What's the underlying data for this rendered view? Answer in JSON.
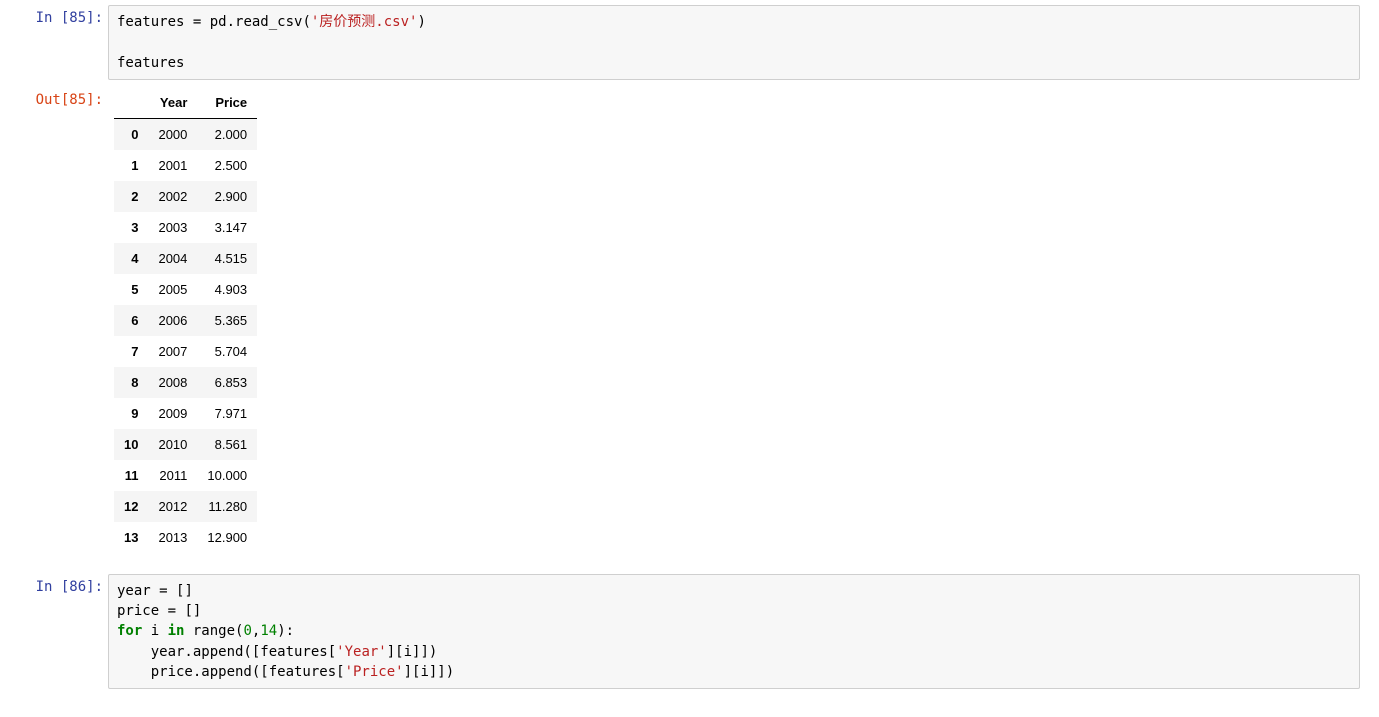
{
  "cell1": {
    "prompt": "In [85]:",
    "line1a": "features ",
    "line1b": "=",
    "line1c": " pd.read_csv(",
    "line1d": "'房价预测.csv'",
    "line1e": ")",
    "line3": "features"
  },
  "out1": {
    "prompt": "Out[85]:",
    "columns": [
      "",
      "Year",
      "Price"
    ],
    "rows": [
      [
        "0",
        "2000",
        "2.000"
      ],
      [
        "1",
        "2001",
        "2.500"
      ],
      [
        "2",
        "2002",
        "2.900"
      ],
      [
        "3",
        "2003",
        "3.147"
      ],
      [
        "4",
        "2004",
        "4.515"
      ],
      [
        "5",
        "2005",
        "4.903"
      ],
      [
        "6",
        "2006",
        "5.365"
      ],
      [
        "7",
        "2007",
        "5.704"
      ],
      [
        "8",
        "2008",
        "6.853"
      ],
      [
        "9",
        "2009",
        "7.971"
      ],
      [
        "10",
        "2010",
        "8.561"
      ],
      [
        "11",
        "2011",
        "10.000"
      ],
      [
        "12",
        "2012",
        "11.280"
      ],
      [
        "13",
        "2013",
        "12.900"
      ]
    ]
  },
  "cell2": {
    "prompt": "In [86]:",
    "l1a": "year ",
    "l1b": "=",
    "l1c": " []",
    "l2a": "price ",
    "l2b": "=",
    "l2c": " []",
    "l3a": "for",
    "l3b": " i ",
    "l3c": "in",
    "l3d": " range(",
    "l3e": "0",
    "l3f": ",",
    "l3g": "14",
    "l3h": "):",
    "l4a": "    year.append([features[",
    "l4b": "'Year'",
    "l4c": "][i]])",
    "l5a": "    price.append([features[",
    "l5b": "'Price'",
    "l5c": "][i]])"
  }
}
